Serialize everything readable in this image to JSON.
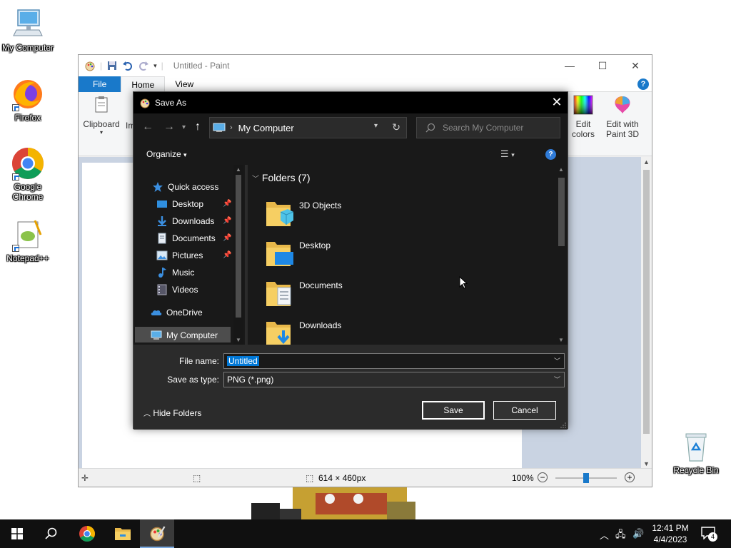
{
  "desktop": {
    "icons": [
      {
        "label": "My Computer"
      },
      {
        "label": "Firefox"
      },
      {
        "label": "Google Chrome"
      },
      {
        "label": "Notepad++"
      },
      {
        "label": "Recycle Bin"
      }
    ]
  },
  "paint": {
    "title": "Untitled - Paint",
    "tabs": [
      "File",
      "Home",
      "View"
    ],
    "groups": {
      "clipboard": "Clipboard",
      "image_partial": "Im",
      "edit_colors_line1": "Edit",
      "edit_colors_line2": "colors",
      "paint3d_line1": "Edit with",
      "paint3d_line2": "Paint 3D"
    },
    "status": {
      "dimensions": "614 × 460px",
      "zoom": "100%",
      "zoom_level": 0.5
    }
  },
  "dialog": {
    "title": "Save As",
    "address": {
      "location": "My Computer"
    },
    "search_placeholder": "Search My Computer",
    "organize_label": "Organize",
    "nav": {
      "quick_access": "Quick access",
      "items": [
        "Desktop",
        "Downloads",
        "Documents",
        "Pictures",
        "Music",
        "Videos"
      ],
      "onedrive": "OneDrive",
      "my_computer": "My Computer"
    },
    "folders_header": "Folders (7)",
    "folders": [
      "3D Objects",
      "Desktop",
      "Documents",
      "Downloads"
    ],
    "form": {
      "file_name_label": "File name:",
      "file_name_value": "Untitled",
      "save_type_label": "Save as type:",
      "save_type_value": "PNG (*.png)",
      "hide_folders": "Hide Folders",
      "save": "Save",
      "cancel": "Cancel"
    }
  },
  "taskbar": {
    "time": "12:41 PM",
    "date": "4/4/2023",
    "notification_count": "4"
  },
  "colors": {
    "accent": "#1979ca",
    "dialog_bg": "#2b2b2b",
    "dialog_pane": "#191919",
    "selection": "#0078d7",
    "taskbar": "#101010"
  }
}
